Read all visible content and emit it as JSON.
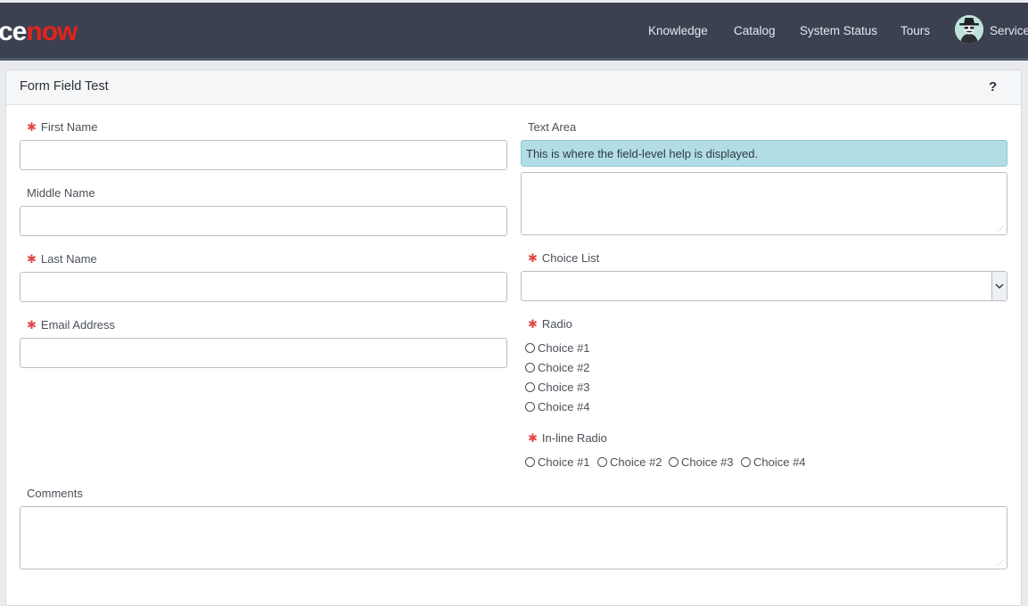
{
  "header": {
    "logo_white": "ce",
    "logo_red": "now",
    "nav": [
      {
        "label": "Knowledge"
      },
      {
        "label": "Catalog"
      },
      {
        "label": "System Status"
      },
      {
        "label": "Tours"
      }
    ],
    "profile_label": "Service"
  },
  "panel": {
    "title": "Form Field Test",
    "help_label": "?"
  },
  "form": {
    "first_name": {
      "label": "First Name",
      "value": ""
    },
    "middle_name": {
      "label": "Middle Name",
      "value": ""
    },
    "last_name": {
      "label": "Last Name",
      "value": ""
    },
    "email": {
      "label": "Email Address",
      "value": ""
    },
    "text_area": {
      "label": "Text Area",
      "help": "This is where the field-level help is displayed.",
      "value": ""
    },
    "choice_list": {
      "label": "Choice List",
      "value": ""
    },
    "radio": {
      "label": "Radio",
      "options": [
        "Choice #1",
        "Choice #2",
        "Choice #3",
        "Choice #4"
      ]
    },
    "inline_radio": {
      "label": "In-line Radio",
      "options": [
        "Choice #1",
        "Choice #2",
        "Choice #3",
        "Choice #4"
      ]
    },
    "comments": {
      "label": "Comments",
      "value": ""
    }
  },
  "colors": {
    "topbar": "#3c4152",
    "brand_red": "#e3231b",
    "required": "#e04848",
    "help_background": "#b2dde6"
  }
}
